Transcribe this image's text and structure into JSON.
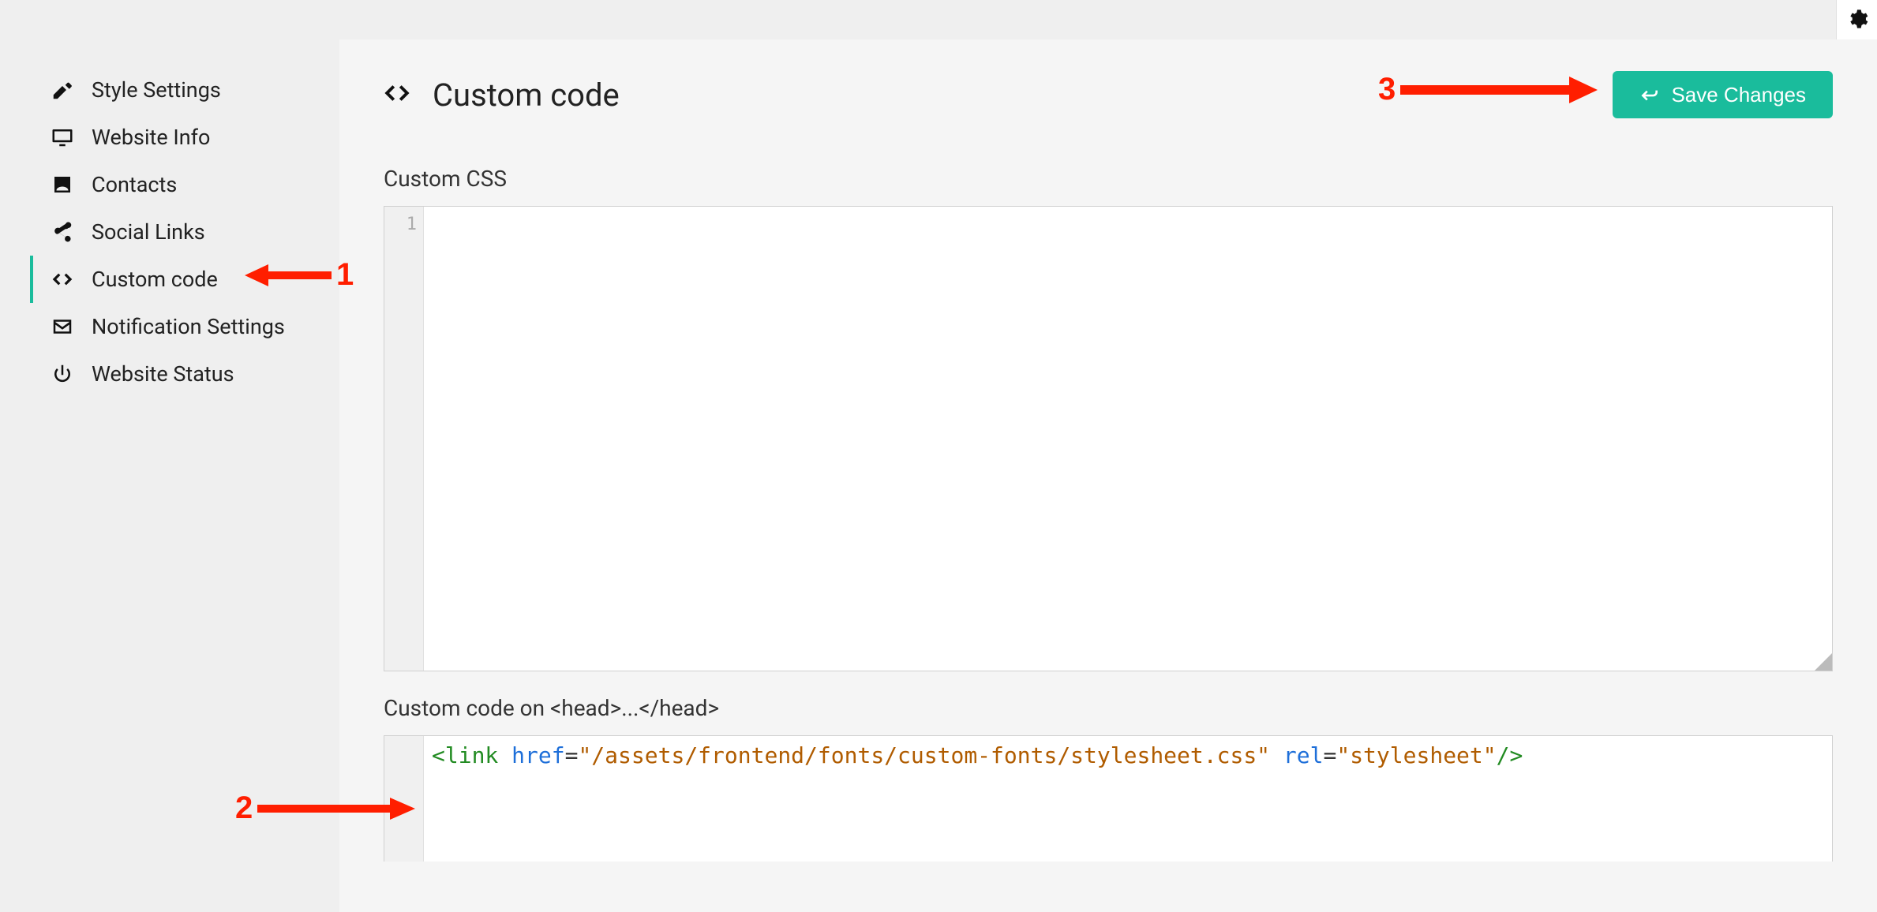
{
  "topbar": {
    "gear_name": "settings-gear"
  },
  "sidebar": {
    "items": [
      {
        "label": "Style Settings",
        "name": "sidebar-item-style-settings",
        "icon": "palette-icon"
      },
      {
        "label": "Website Info",
        "name": "sidebar-item-website-info",
        "icon": "monitor-icon"
      },
      {
        "label": "Contacts",
        "name": "sidebar-item-contacts",
        "icon": "contacts-icon"
      },
      {
        "label": "Social Links",
        "name": "sidebar-item-social-links",
        "icon": "share-icon"
      },
      {
        "label": "Custom code",
        "name": "sidebar-item-custom-code",
        "icon": "code-icon",
        "active": true
      },
      {
        "label": "Notification Settings",
        "name": "sidebar-item-notification-settings",
        "icon": "mail-icon"
      },
      {
        "label": "Website Status",
        "name": "sidebar-item-website-status",
        "icon": "power-icon"
      }
    ]
  },
  "page": {
    "title": "Custom code",
    "save_label": "Save Changes",
    "sections": {
      "css_label": "Custom CSS",
      "head_label": "Custom code on <head>...</head>"
    }
  },
  "editors": {
    "css": {
      "gutter": [
        "1"
      ],
      "content": ""
    },
    "head": {
      "content_plain": "<link href=\"/assets/frontend/fonts/custom-fonts/stylesheet.css\" rel=\"stylesheet\"/>",
      "tokens": [
        {
          "t": "<",
          "c": "bracket"
        },
        {
          "t": "link",
          "c": "tag"
        },
        {
          "t": " ",
          "c": "ws"
        },
        {
          "t": "href",
          "c": "attr"
        },
        {
          "t": "=",
          "c": "eq"
        },
        {
          "t": "\"/assets/frontend/fonts/custom-fonts/stylesheet.css\"",
          "c": "str"
        },
        {
          "t": " ",
          "c": "ws"
        },
        {
          "t": "rel",
          "c": "attr"
        },
        {
          "t": "=",
          "c": "eq"
        },
        {
          "t": "\"stylesheet\"",
          "c": "str"
        },
        {
          "t": "/>",
          "c": "bracket"
        }
      ]
    }
  },
  "annotations": {
    "a1": "1",
    "a2": "2",
    "a3": "3"
  }
}
